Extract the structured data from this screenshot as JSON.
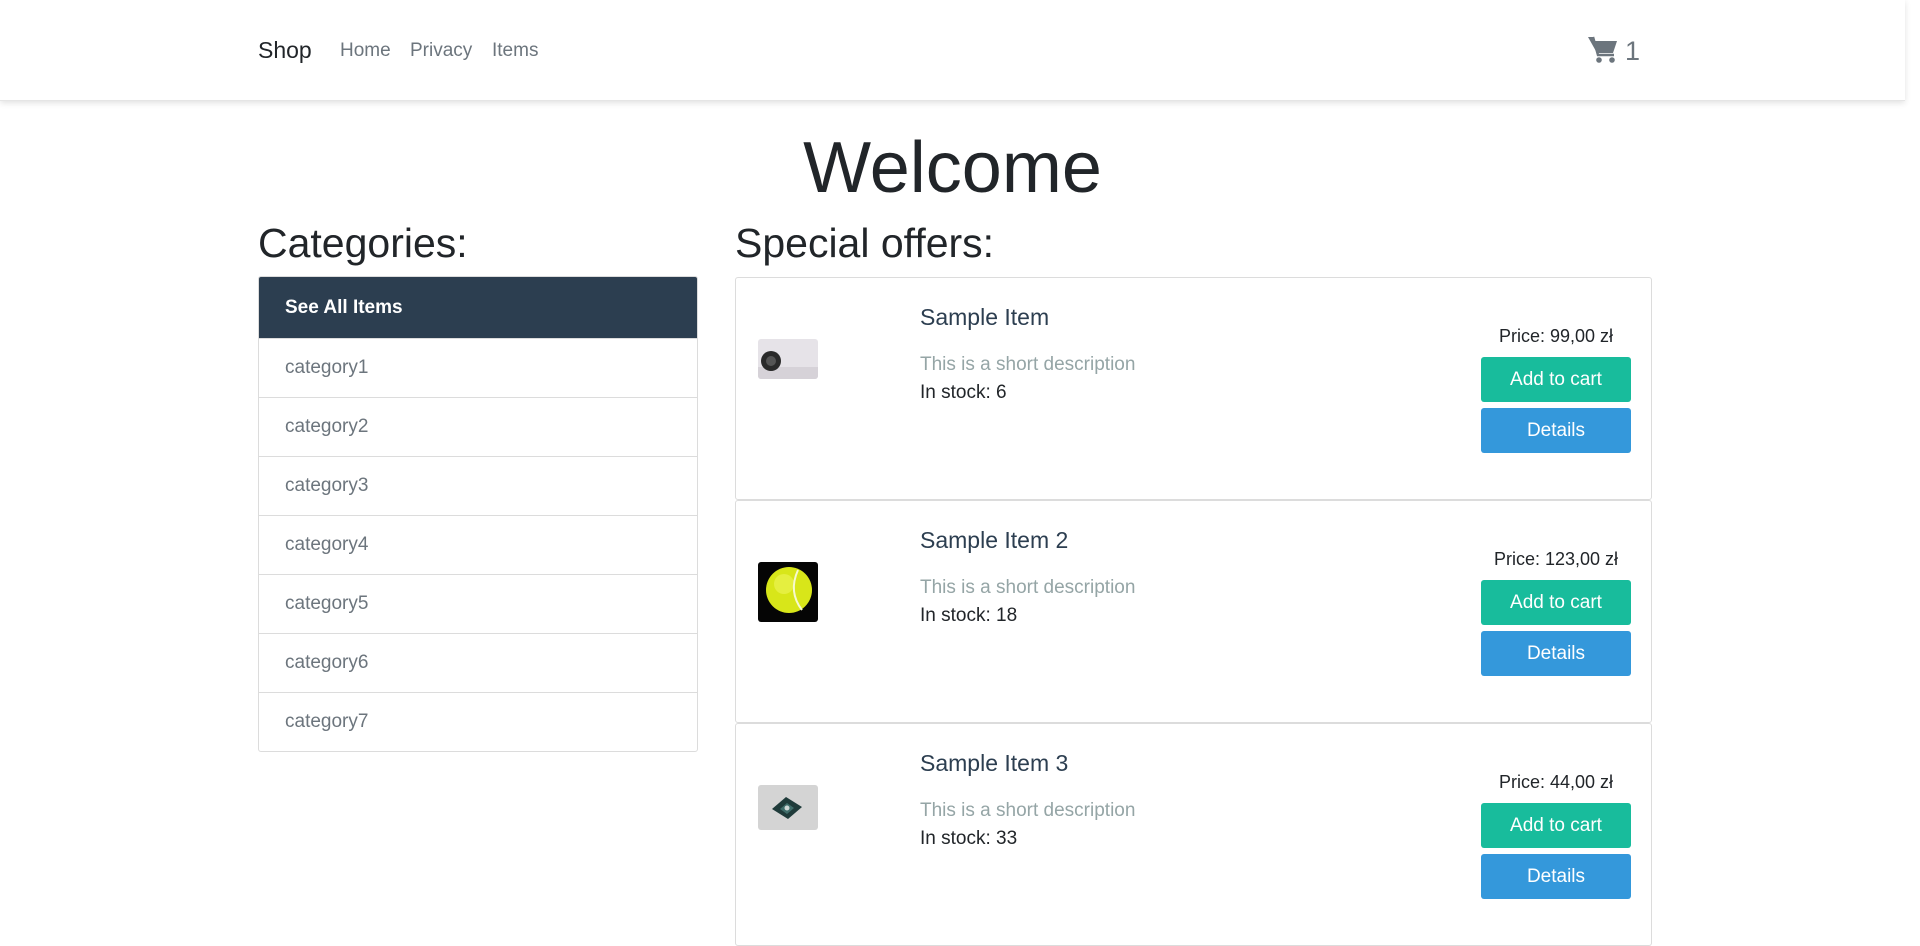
{
  "navbar": {
    "brand": "Shop",
    "links": [
      "Home",
      "Privacy",
      "Items"
    ],
    "cart_icon": "shopping-cart-icon",
    "cart_count": "1"
  },
  "welcome": "Welcome",
  "categories": {
    "title": "Categories:",
    "all_label": "See All Items",
    "items": [
      "category1",
      "category2",
      "category3",
      "category4",
      "category5",
      "category6",
      "category7"
    ]
  },
  "offers": {
    "title": "Special offers:",
    "items": [
      {
        "name": "Sample Item",
        "description": "This is a short description",
        "stock": "In stock: 6",
        "price": "Price: 99,00 zł",
        "add_label": "Add to cart",
        "details_label": "Details"
      },
      {
        "name": "Sample Item 2",
        "description": "This is a short description",
        "stock": "In stock: 18",
        "price": "Price: 123,00 zł",
        "add_label": "Add to cart",
        "details_label": "Details"
      },
      {
        "name": "Sample Item 3",
        "description": "This is a short description",
        "stock": "In stock: 33",
        "price": "Price: 44,00 zł",
        "add_label": "Add to cart",
        "details_label": "Details"
      }
    ]
  },
  "colors": {
    "navbar_bg": "#ffffff",
    "category_active_bg": "#2c3e50",
    "add_to_cart": "#18bc9c",
    "details": "#3498db",
    "muted_text": "#6c757d",
    "description_text": "#95a5a6"
  }
}
